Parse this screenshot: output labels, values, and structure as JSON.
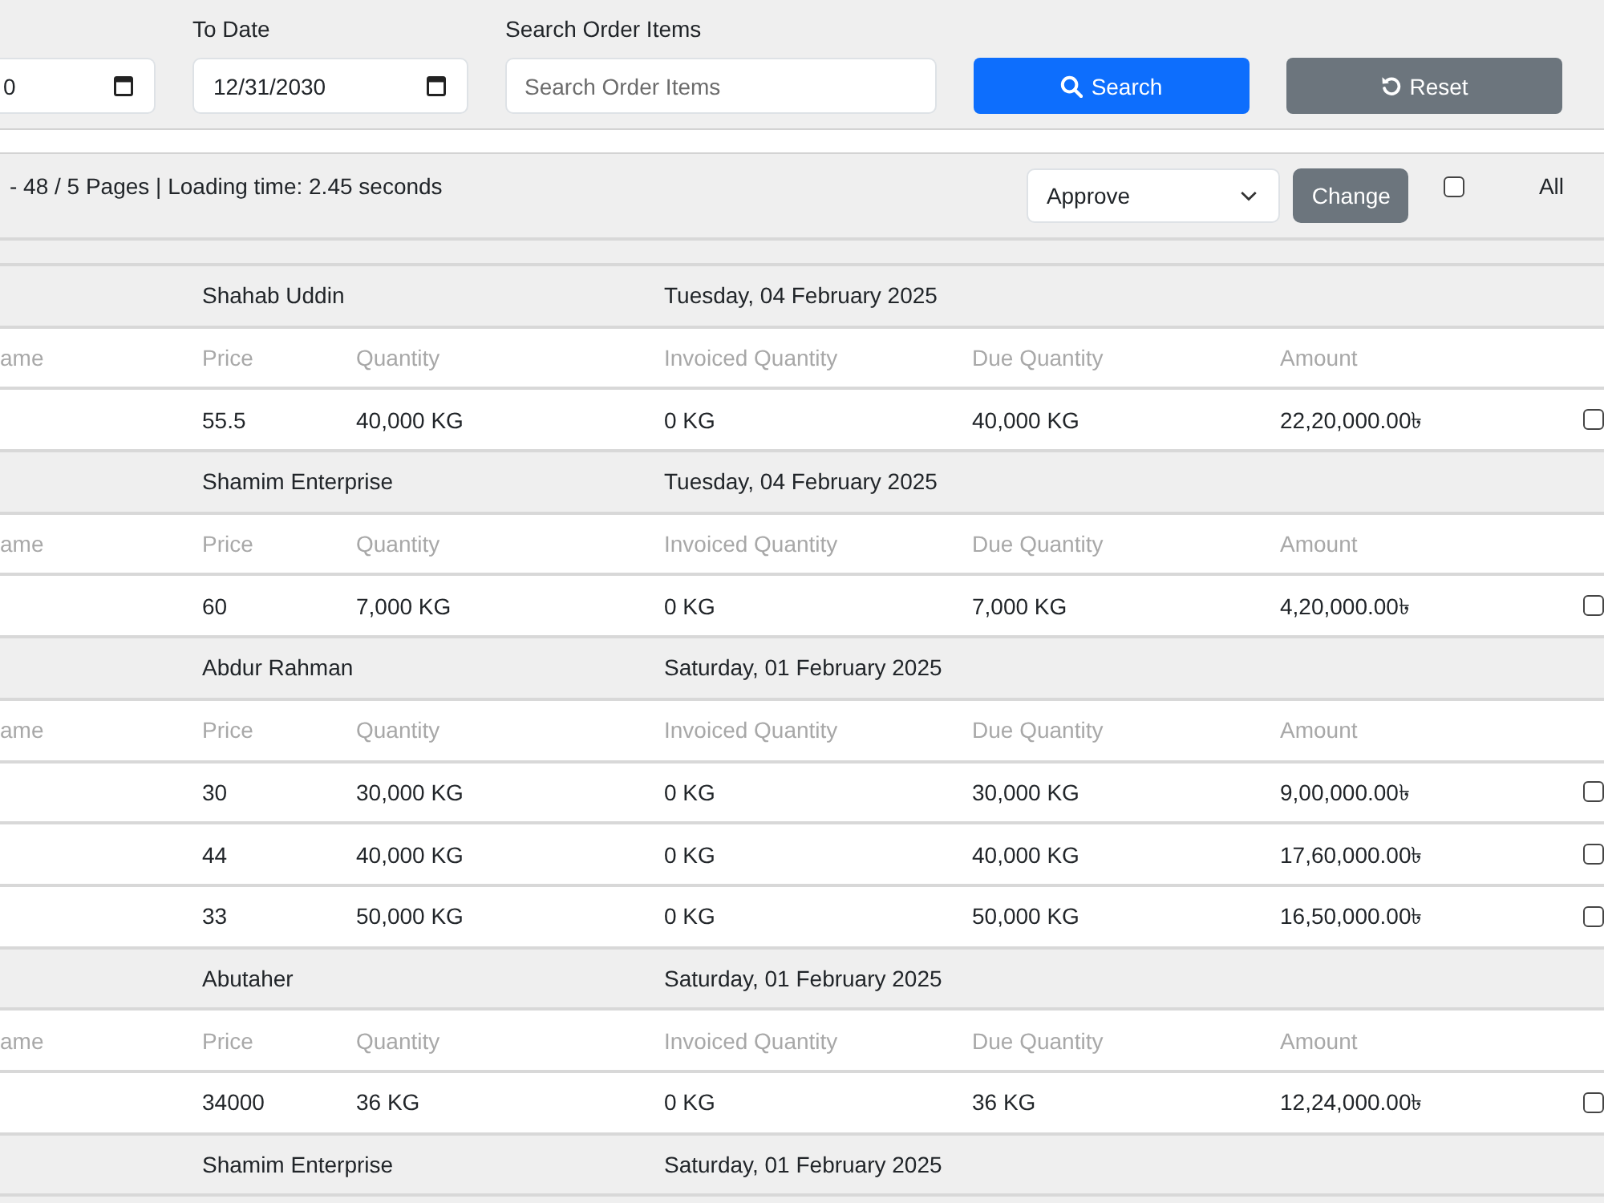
{
  "filters": [
    {
      "kind": "date",
      "value": "0"
    },
    {
      "kind": "date",
      "label": "To Date",
      "value": "12/31/2030"
    },
    {
      "kind": "search",
      "label": "Search Order Items",
      "placeholder": "Search Order Items"
    }
  ],
  "actions": [
    {
      "kind": "search",
      "label": "Search"
    },
    {
      "kind": "reset",
      "label": "Reset"
    }
  ],
  "summary": {
    "text": "- 48 / 5 Pages | Loading time: 2.45 seconds"
  },
  "bulk": {
    "status_select": "Approve",
    "button": "Change",
    "select_all": {
      "checked": false,
      "label": "All"
    }
  },
  "orders": [
    {
      "customer": "Shahab Uddin",
      "date": "Tuesday, 04 February 2025",
      "columns": [
        "ame",
        "Price",
        "Quantity",
        "Invoiced Quantity",
        "Due Quantity",
        "Amount"
      ],
      "items": [
        {
          "price": "55.5",
          "quantity": "40,000 KG",
          "invoiced_quantity": "0 KG",
          "due_quantity": "40,000 KG",
          "amount": "22,20,000.00৳",
          "checked": false
        }
      ]
    },
    {
      "customer": "Shamim Enterprise",
      "date": "Tuesday, 04 February 2025",
      "columns": [
        "ame",
        "Price",
        "Quantity",
        "Invoiced Quantity",
        "Due Quantity",
        "Amount"
      ],
      "items": [
        {
          "price": "60",
          "quantity": "7,000 KG",
          "invoiced_quantity": "0 KG",
          "due_quantity": "7,000 KG",
          "amount": "4,20,000.00৳",
          "checked": false
        }
      ]
    },
    {
      "customer": "Abdur Rahman",
      "date": "Saturday, 01 February 2025",
      "columns": [
        "ame",
        "Price",
        "Quantity",
        "Invoiced Quantity",
        "Due Quantity",
        "Amount"
      ],
      "items": [
        {
          "price": "30",
          "quantity": "30,000 KG",
          "invoiced_quantity": "0 KG",
          "due_quantity": "30,000 KG",
          "amount": "9,00,000.00৳",
          "checked": false
        },
        {
          "price": "44",
          "quantity": "40,000 KG",
          "invoiced_quantity": "0 KG",
          "due_quantity": "40,000 KG",
          "amount": "17,60,000.00৳",
          "checked": false
        },
        {
          "price": "33",
          "quantity": "50,000 KG",
          "invoiced_quantity": "0 KG",
          "due_quantity": "50,000 KG",
          "amount": "16,50,000.00৳",
          "checked": false
        }
      ]
    },
    {
      "customer": "Abutaher",
      "date": "Saturday, 01 February 2025",
      "columns": [
        "ame",
        "Price",
        "Quantity",
        "Invoiced Quantity",
        "Due Quantity",
        "Amount"
      ],
      "items": [
        {
          "price": "34000",
          "quantity": "36 KG",
          "invoiced_quantity": "0 KG",
          "due_quantity": "36 KG",
          "amount": "12,24,000.00৳",
          "checked": false
        }
      ]
    },
    {
      "customer": "Shamim Enterprise",
      "date": "Saturday, 01 February 2025"
    }
  ]
}
